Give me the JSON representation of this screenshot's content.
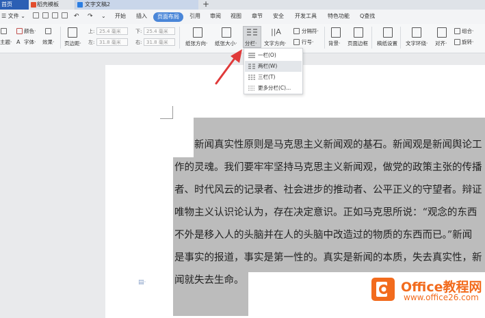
{
  "tabs": {
    "home": "首页",
    "template": "稻壳模板",
    "document": "文字文稿2",
    "add": "+"
  },
  "menu": {
    "file": "☰ 文件 ⌄",
    "items": [
      "开始",
      "插入",
      "页面布局",
      "引用",
      "审阅",
      "视图",
      "章节",
      "安全",
      "开发工具",
      "特色功能"
    ],
    "active": "页面布局",
    "search": "Q查找"
  },
  "ribbon": {
    "theme": "主题·",
    "colors": "颜色·",
    "fonts": "字体·",
    "effects": "效果·",
    "margins": "页边距·",
    "margin_top_label": "上:",
    "margin_top": "25.4 毫米",
    "margin_bottom_label": "下:",
    "margin_bottom": "25.4 毫米",
    "margin_left_label": "左:",
    "margin_left": "31.8 毫米",
    "margin_right_label": "右:",
    "margin_right": "31.8 毫米",
    "orientation": "纸张方向·",
    "size": "纸张大小·",
    "columns": "分栏·",
    "text_direction": "文字方向·",
    "separator": "分隔符·",
    "line_number": "行号·",
    "background": "背景·",
    "page_border": "页面边框",
    "manuscript": "稿纸设置",
    "text_wrap": "文字环绕·",
    "align": "对齐·",
    "group": "组合·",
    "rotate": "旋转·"
  },
  "columns_menu": {
    "items": [
      {
        "label": "一栏(O)",
        "hover": false
      },
      {
        "label": "两栏(W)",
        "hover": true
      },
      {
        "label": "三栏(T)",
        "hover": false
      },
      {
        "label": "更多分栏(C)...",
        "hover": false
      }
    ]
  },
  "document": {
    "lines": [
      "　　新闻真实性原则是马克思主义新闻观的基石。新闻观是新闻舆论工",
      "作的灵魂。我们要牢牢坚持马克思主义新闻观，做党的政策主张的传播",
      "者、时代风云的记录者、社会进步的推动者、公平正义的守望者。辩证",
      "唯物主义认识论认为，存在决定意识。正如马克思所说：“观念的东西",
      "不外是移入人的头脑并在人的头脑中改造过的物质的东西而已。”新闻",
      "是事实的报道，事实是第一性的。真实是新闻的本质，失去真实性，新",
      "闻就失去生命。"
    ]
  },
  "watermark": {
    "brand": "Office教程网",
    "url": "www.office26.com"
  },
  "colors": {
    "accent": "#4a86d8",
    "tab_home": "#2b5fb4",
    "selection": "#bcbcbc",
    "arrow": "#e03a3a",
    "watermark": "#f26b1d"
  }
}
